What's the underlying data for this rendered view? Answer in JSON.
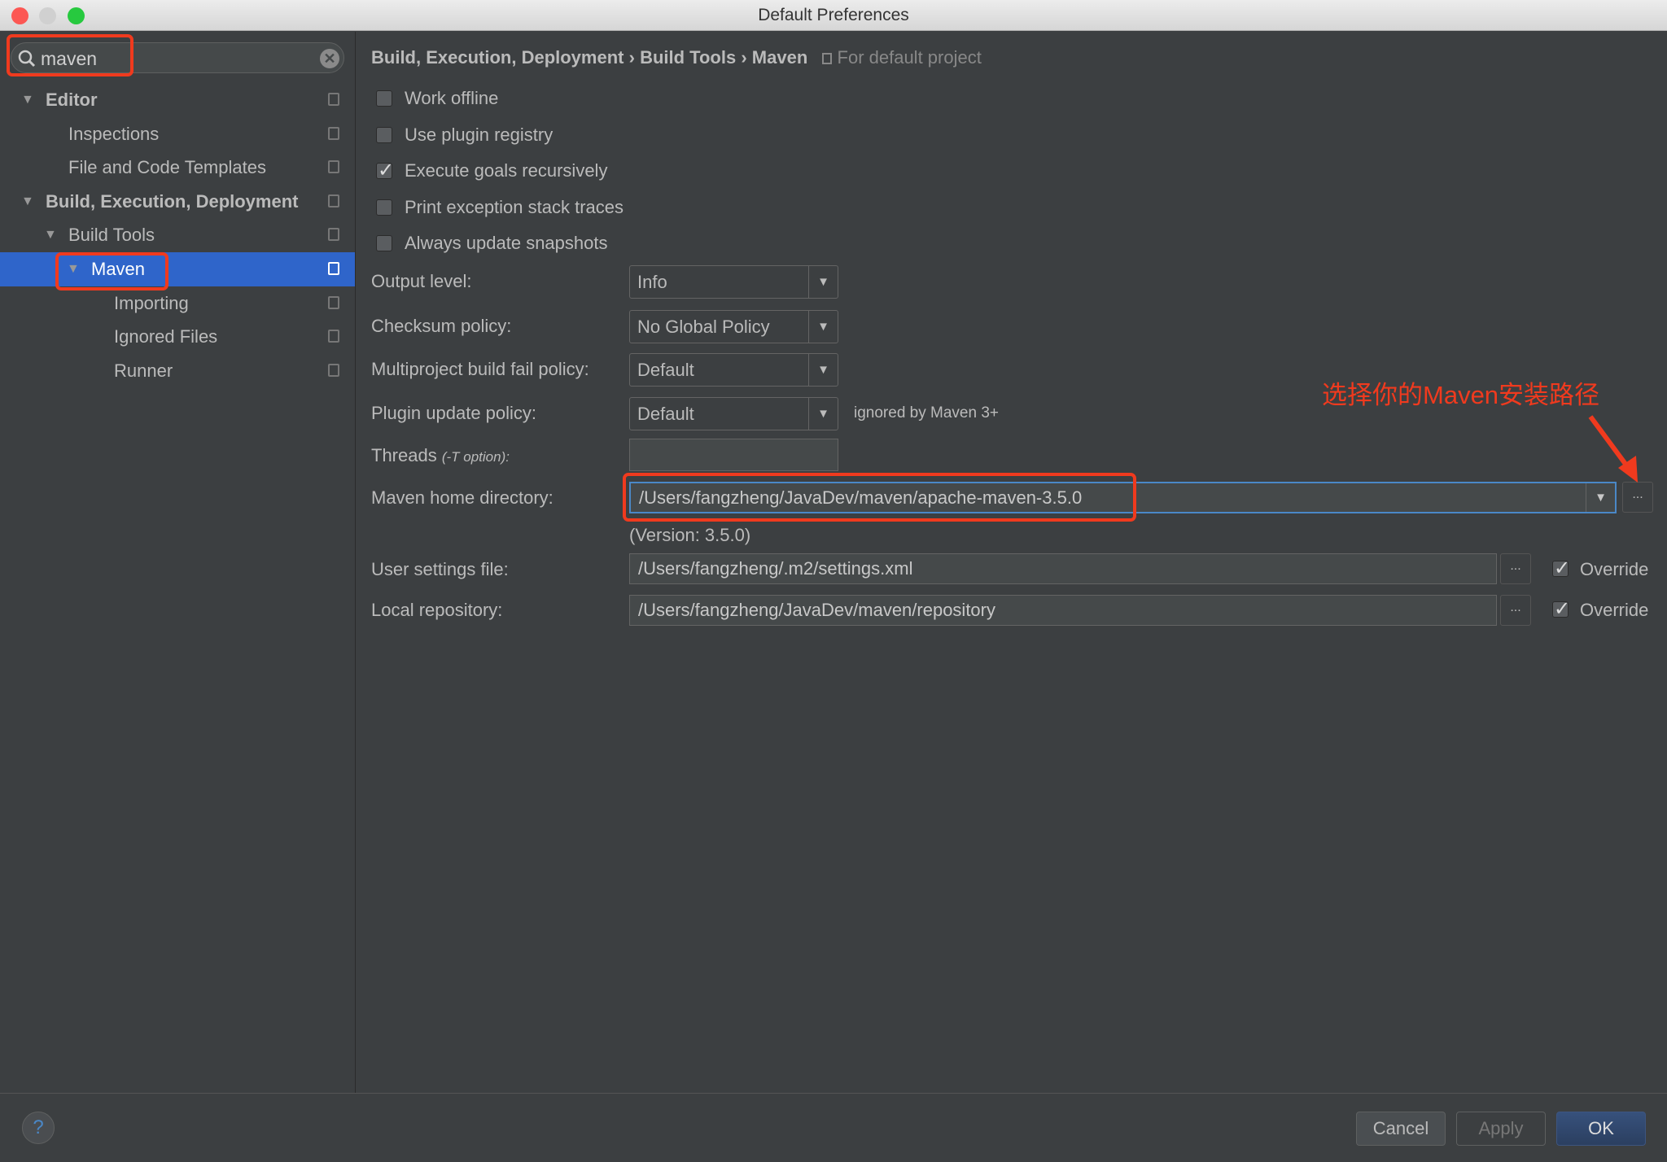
{
  "window": {
    "title": "Default Preferences"
  },
  "search": {
    "value": "maven"
  },
  "tree": [
    {
      "label": "Editor",
      "level": 0,
      "expanded": true,
      "bold": true
    },
    {
      "label": "Inspections",
      "level": 1
    },
    {
      "label": "File and Code Templates",
      "level": 1
    },
    {
      "label": "Build, Execution, Deployment",
      "level": 0,
      "expanded": true,
      "bold": true
    },
    {
      "label": "Build Tools",
      "level": 1,
      "expanded": true
    },
    {
      "label": "Maven",
      "level": 2,
      "expanded": true,
      "selected": true
    },
    {
      "label": "Importing",
      "level": 3
    },
    {
      "label": "Ignored Files",
      "level": 3
    },
    {
      "label": "Runner",
      "level": 3
    }
  ],
  "breadcrumb": {
    "items": [
      "Build, Execution, Deployment",
      "Build Tools",
      "Maven"
    ],
    "sep": "›",
    "scope": "For default project"
  },
  "checkboxes": [
    {
      "label": "Work offline",
      "checked": false
    },
    {
      "label": "Use plugin registry",
      "checked": false
    },
    {
      "label": "Execute goals recursively",
      "checked": true
    },
    {
      "label": "Print exception stack traces",
      "checked": false
    },
    {
      "label": "Always update snapshots",
      "checked": false
    }
  ],
  "combos": [
    {
      "label": "Output level:",
      "value": "Info"
    },
    {
      "label": "Checksum policy:",
      "value": "No Global Policy"
    },
    {
      "label": "Multiproject build fail policy:",
      "value": "Default"
    },
    {
      "label": "Plugin update policy:",
      "value": "Default",
      "note": "ignored by Maven 3+"
    }
  ],
  "threads": {
    "label": "Threads",
    "hint": "(-T option):",
    "value": ""
  },
  "maven_home": {
    "label": "Maven home directory:",
    "value": "/Users/fangzheng/JavaDev/maven/apache-maven-3.5.0",
    "version": "(Version: 3.5.0)"
  },
  "user_settings": {
    "label": "User settings file:",
    "value": "/Users/fangzheng/.m2/settings.xml",
    "override": "Override",
    "checked": true
  },
  "local_repo": {
    "label": "Local repository:",
    "value": "/Users/fangzheng/JavaDev/maven/repository",
    "override": "Override",
    "checked": true
  },
  "browse": "...",
  "annotation": {
    "text": "选择你的Maven安装路径",
    "color": "#f03a1e"
  },
  "buttons": {
    "help": "?",
    "cancel": "Cancel",
    "apply": "Apply",
    "ok": "OK"
  },
  "colors": {
    "selection": "#2f65ca",
    "background": "#3c3f41"
  }
}
